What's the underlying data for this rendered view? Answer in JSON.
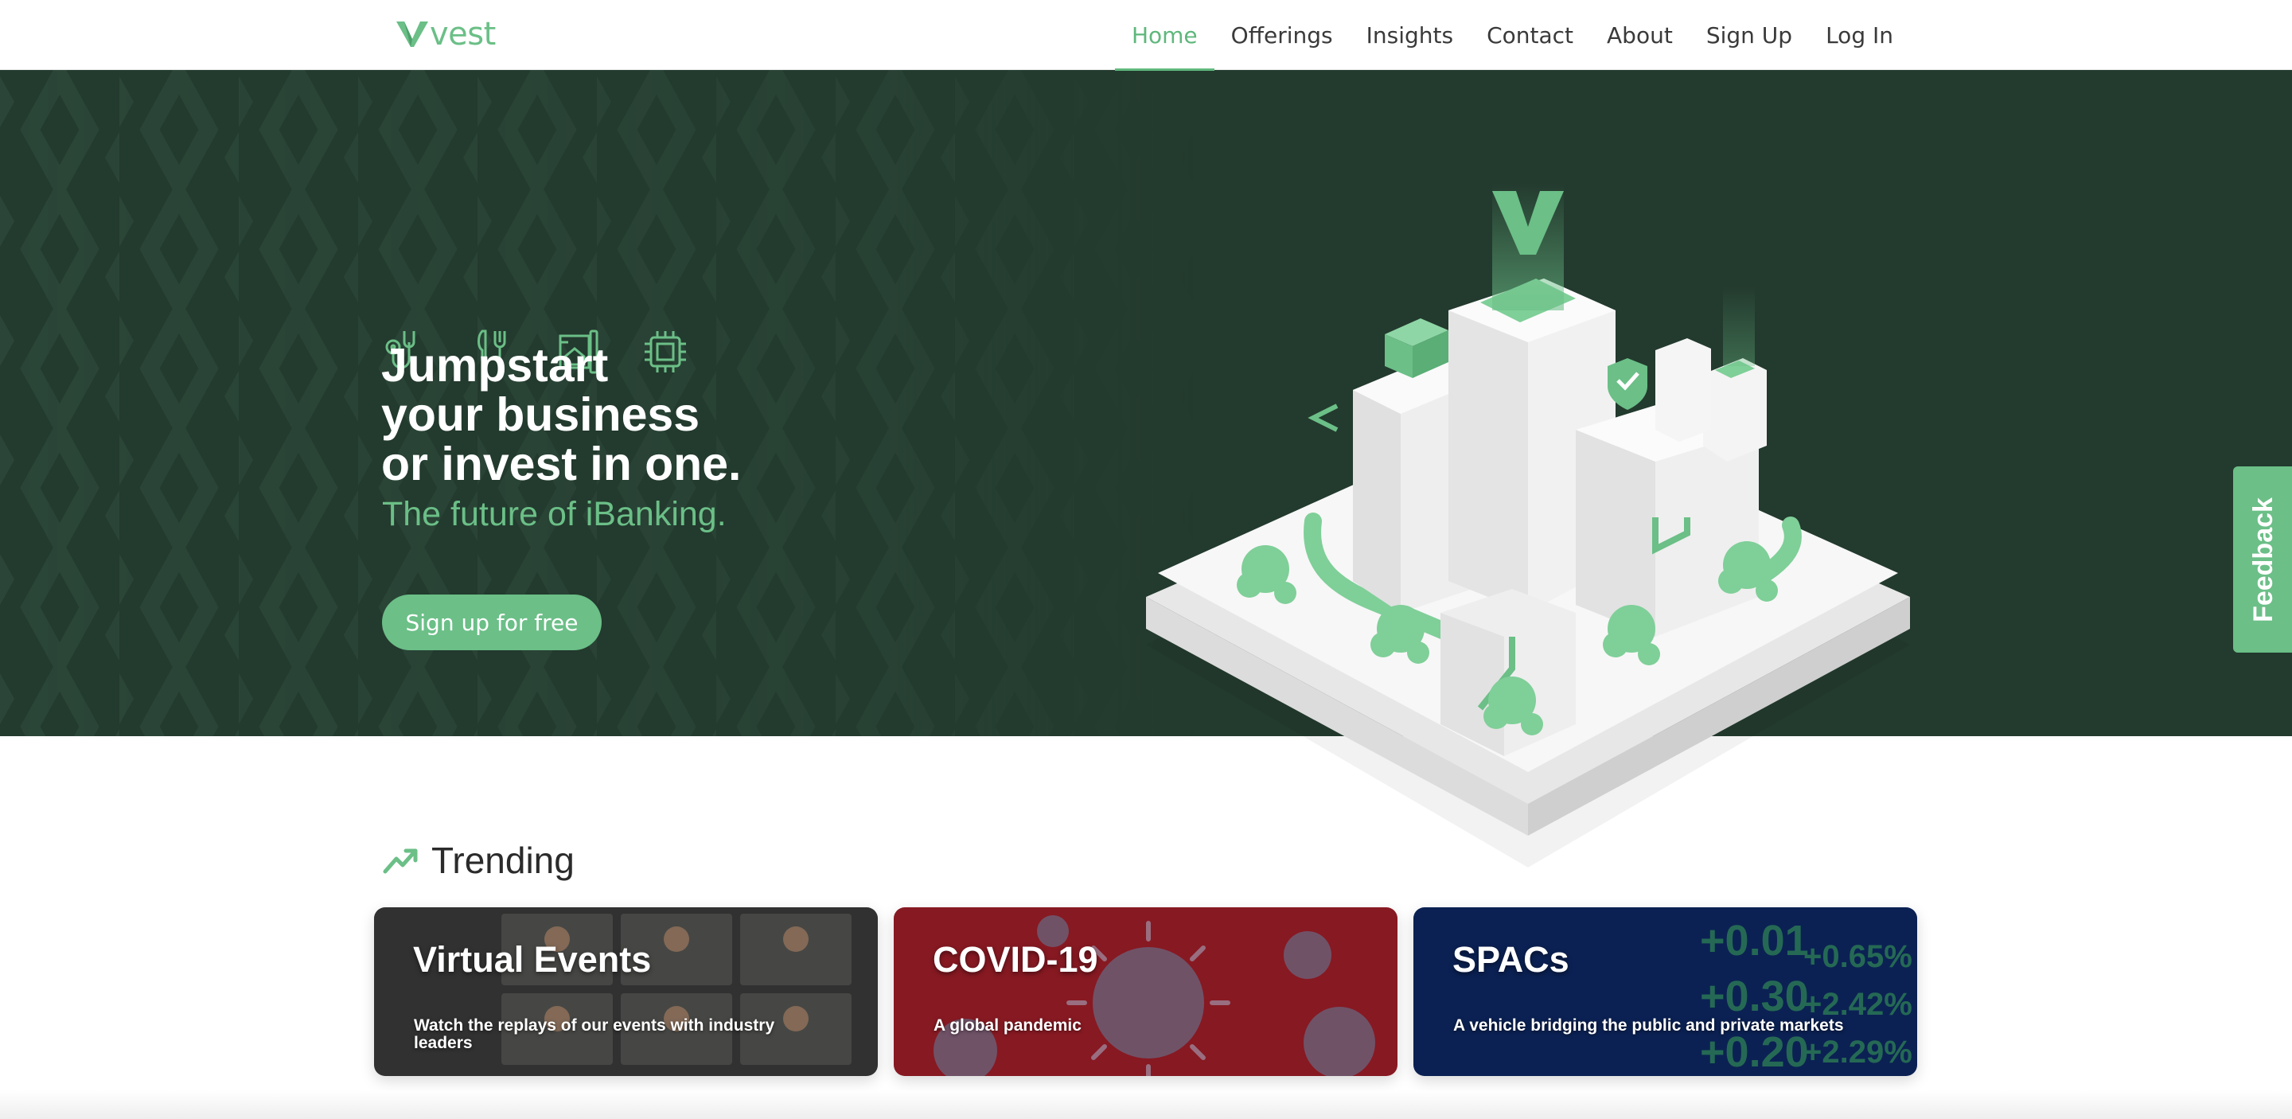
{
  "brand": {
    "name": "vest",
    "accent": "#6bbf87",
    "hero_bg": "#233a2e"
  },
  "nav": {
    "items": [
      {
        "label": "Home",
        "active": true
      },
      {
        "label": "Offerings"
      },
      {
        "label": "Insights"
      },
      {
        "label": "Contact"
      },
      {
        "label": "About"
      },
      {
        "label": "Sign Up"
      },
      {
        "label": "Log In"
      }
    ]
  },
  "hero": {
    "icons": [
      "stethoscope-icon",
      "fork-knife-icon",
      "appliance-icon",
      "chip-icon"
    ],
    "title_lines": [
      "Jumpstart",
      "your business",
      "or invest in one."
    ],
    "subtitle": "The future of iBanking.",
    "cta_label": "Sign up for free"
  },
  "feedback_label": "Feedback",
  "trending": {
    "title": "Trending",
    "cards": [
      {
        "title": "Virtual Events",
        "desc": "Watch the replays of our events with industry leaders",
        "theme": "#5b5c58"
      },
      {
        "title": "COVID-19",
        "desc": "A global pandemic",
        "theme": "#b3202c"
      },
      {
        "title": "SPACs",
        "desc": "A vehicle bridging the public and private markets",
        "theme": "#0d2b6e"
      }
    ]
  }
}
